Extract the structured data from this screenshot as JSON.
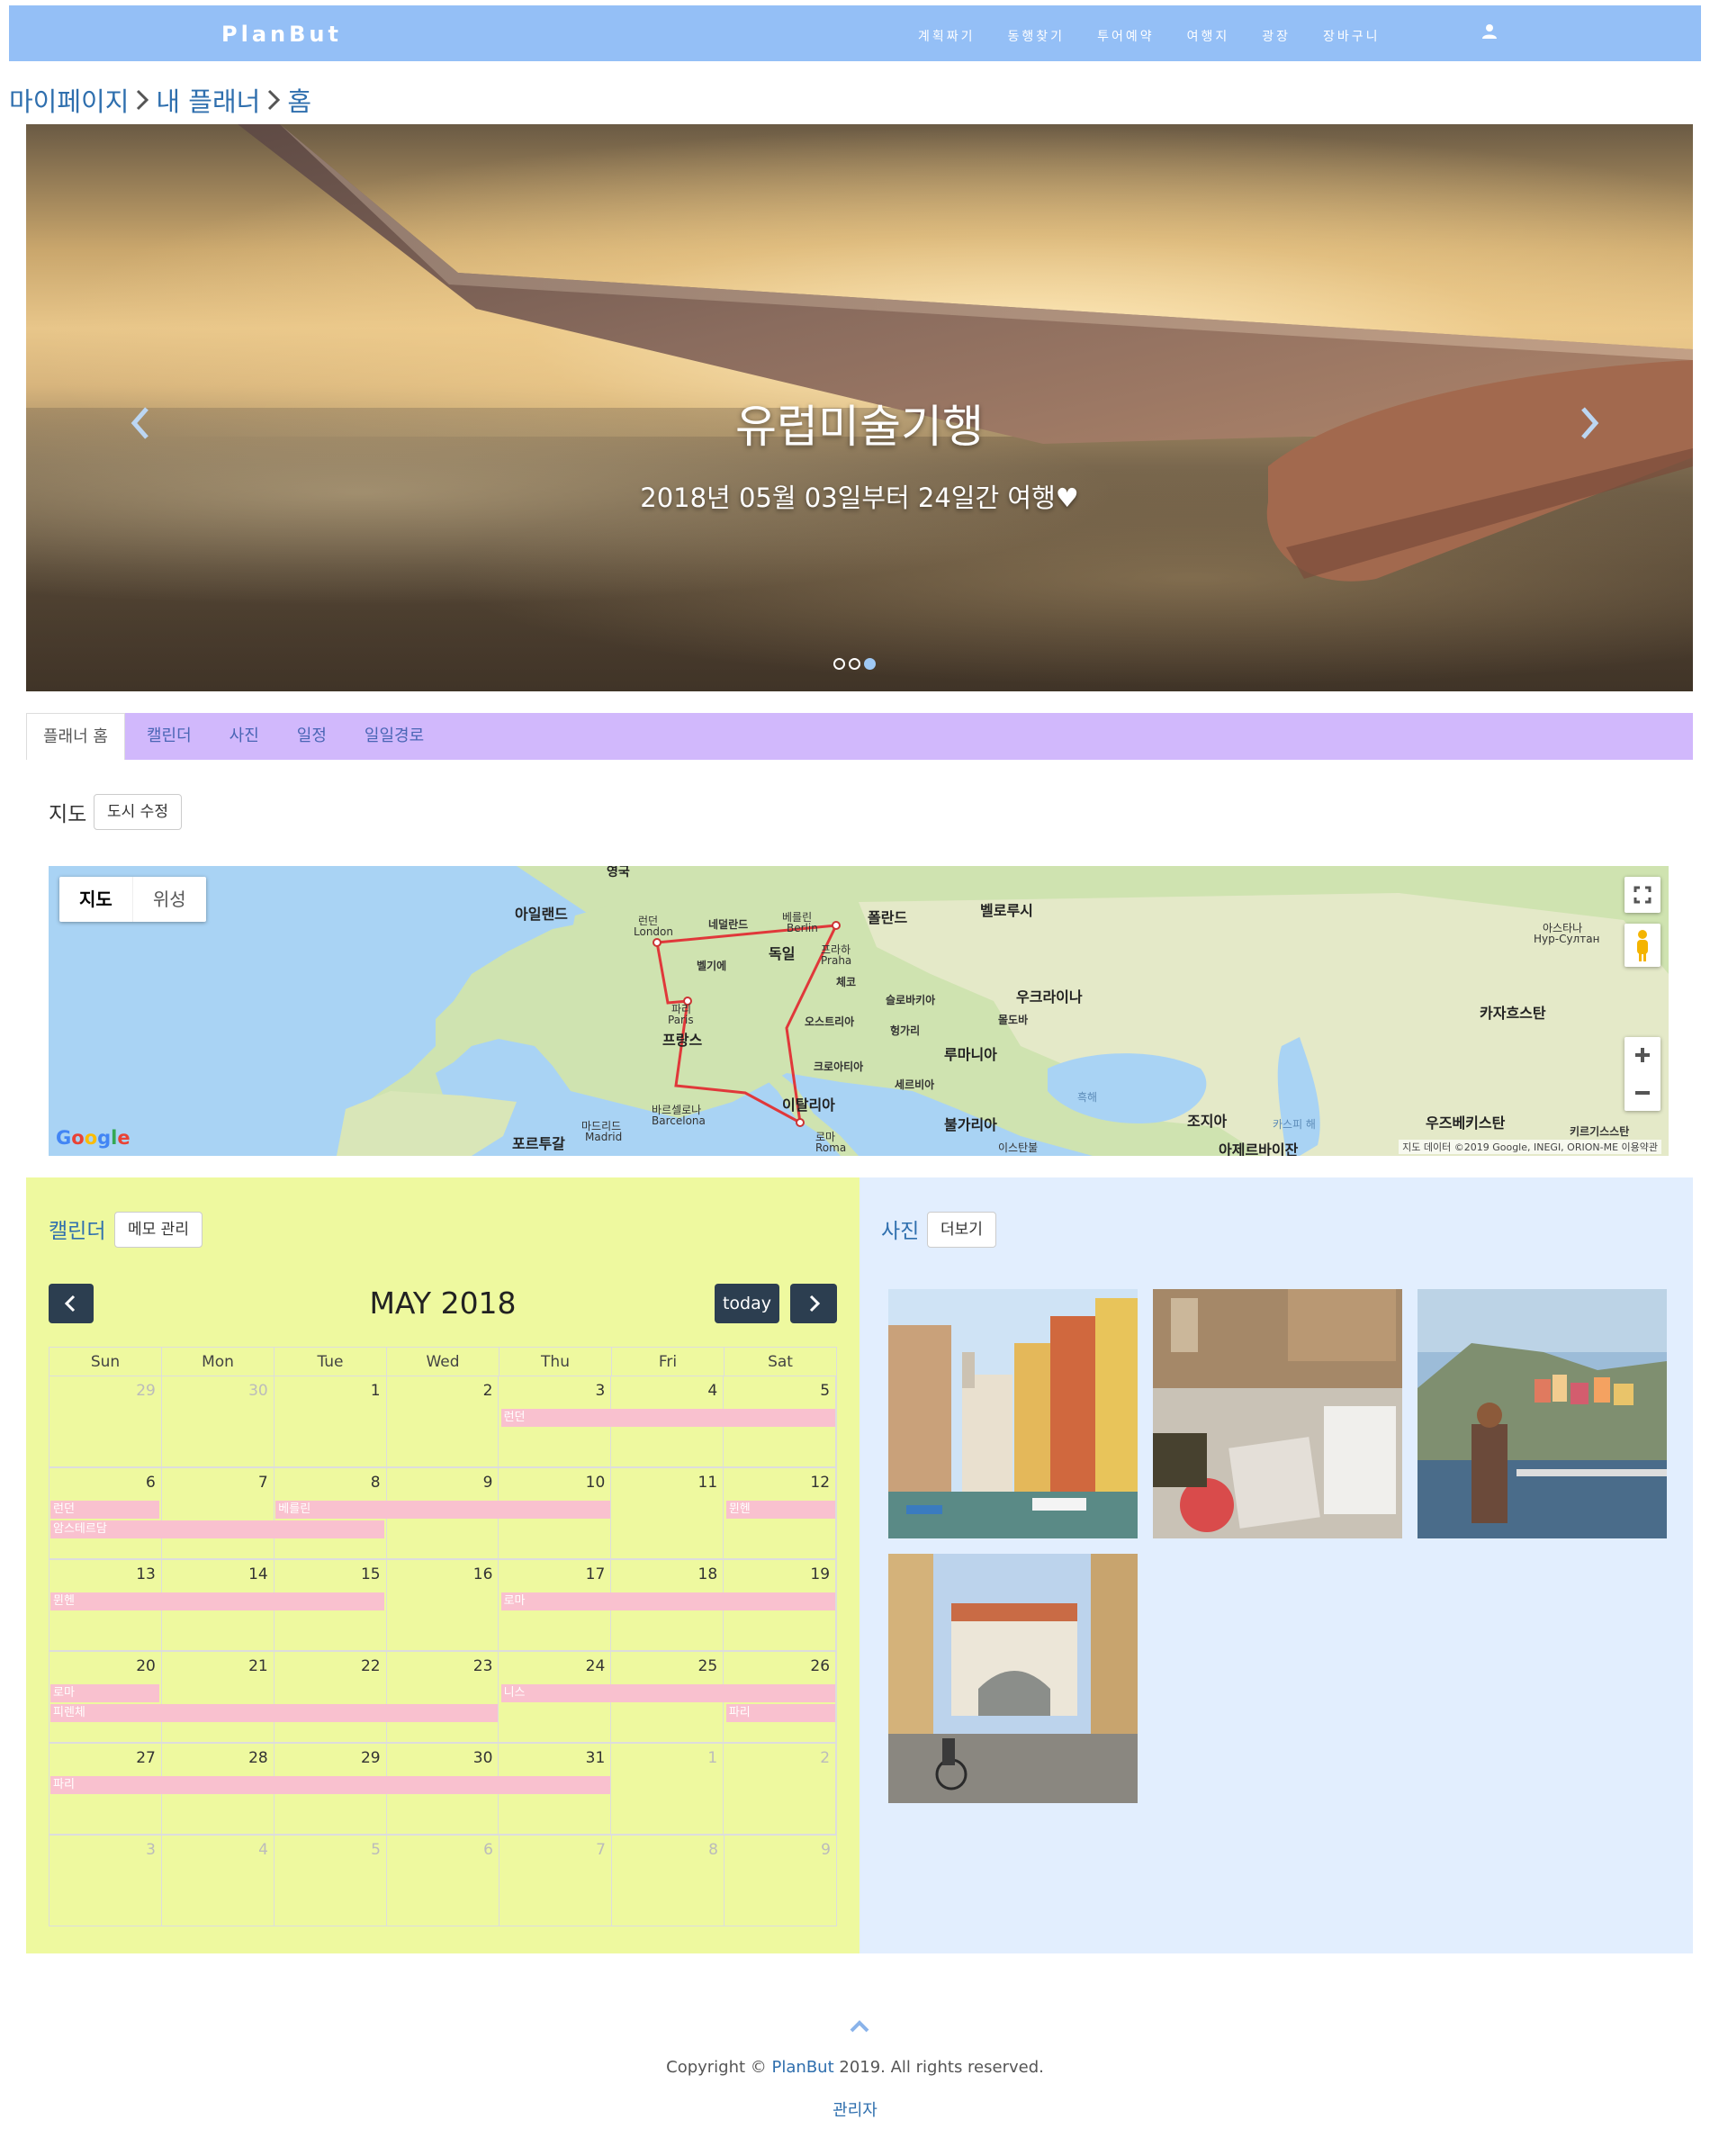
{
  "nav": {
    "brand": "PlanBut",
    "links": [
      "계획짜기",
      "동행찾기",
      "투어예약",
      "여행지",
      "광장",
      "장바구니"
    ]
  },
  "breadcrumb": [
    "마이페이지",
    "내 플래너",
    "홈"
  ],
  "hero": {
    "title": "유럽미술기행",
    "subtitle": "2018년 05월 03일부터 24일간 여행♥",
    "slide_count": 3,
    "active_slide": 3
  },
  "tabs": [
    "플래너 홈",
    "캘린더",
    "사진",
    "일정",
    "일일경로"
  ],
  "map_section": {
    "heading": "지도",
    "edit_button": "도시 수정",
    "map_type": [
      "지도",
      "위성"
    ],
    "labels": {
      "uk": "영국",
      "ireland": "아일랜드",
      "london": "런던",
      "london_en": "London",
      "netherlands": "네덜란드",
      "berlin": "베를린",
      "berlin_en": "Berlin",
      "germany": "독일",
      "poland": "폴란드",
      "belarus": "벨로루시",
      "belgium": "벨기에",
      "prague": "프라하",
      "prague_en": "Praha",
      "czech": "체코",
      "paris": "파리",
      "paris_en": "Paris",
      "france": "프랑스",
      "slovakia": "슬로바키아",
      "ukraine": "우크라이나",
      "moldova": "몰도바",
      "austria": "오스트리아",
      "hungary": "헝가리",
      "romania": "루마니아",
      "croatia": "크로아티아",
      "serbia": "세르비아",
      "italy": "이탈리아",
      "barcelona": "바르셀로나",
      "barcelona_en": "Barcelona",
      "madrid": "마드리드",
      "madrid_en": "Madrid",
      "portugal": "포르투갈",
      "rome": "로마",
      "rome_en": "Roma",
      "bulgaria": "불가리아",
      "istanbul": "이스탄불",
      "blacksea": "흑해",
      "georgia": "조지아",
      "azerbaijan": "아제르바이잔",
      "caspian": "카스피 해",
      "kazakhstan": "카자흐스탄",
      "astana": "아스타나",
      "astana_ru": "Нур-Султан",
      "uzbekistan": "우즈베키스탄",
      "kyrgyzstan": "키르기스스탄"
    },
    "google": "Google",
    "copyright": "지도 데이터 ©2019 Google, INEGI, ORION-ME  이용약관"
  },
  "calendar": {
    "title": "캘린더",
    "memo_button": "메모 관리",
    "month_title": "MAY 2018",
    "today_button": "today",
    "weekdays": [
      "Sun",
      "Mon",
      "Tue",
      "Wed",
      "Thu",
      "Fri",
      "Sat"
    ],
    "weeks": [
      {
        "days": [
          "29",
          "30",
          "1",
          "2",
          "3",
          "4",
          "5"
        ],
        "other": [
          true,
          true,
          false,
          false,
          false,
          false,
          false
        ]
      },
      {
        "days": [
          "6",
          "7",
          "8",
          "9",
          "10",
          "11",
          "12"
        ],
        "other": [
          false,
          false,
          false,
          false,
          false,
          false,
          false
        ]
      },
      {
        "days": [
          "13",
          "14",
          "15",
          "16",
          "17",
          "18",
          "19"
        ],
        "other": [
          false,
          false,
          false,
          false,
          false,
          false,
          false
        ]
      },
      {
        "days": [
          "20",
          "21",
          "22",
          "23",
          "24",
          "25",
          "26"
        ],
        "other": [
          false,
          false,
          false,
          false,
          false,
          false,
          false
        ]
      },
      {
        "days": [
          "27",
          "28",
          "29",
          "30",
          "31",
          "1",
          "2"
        ],
        "other": [
          false,
          false,
          false,
          false,
          false,
          true,
          true
        ]
      },
      {
        "days": [
          "3",
          "4",
          "5",
          "6",
          "7",
          "8",
          "9"
        ],
        "other": [
          true,
          true,
          true,
          true,
          true,
          true,
          true
        ]
      }
    ],
    "events": [
      {
        "label": "런던",
        "week": 0,
        "start": 4,
        "span": 3,
        "row": 0
      },
      {
        "label": "런던",
        "week": 1,
        "start": 0,
        "span": 1,
        "row": 0
      },
      {
        "label": "베를린",
        "week": 1,
        "start": 2,
        "span": 3,
        "row": 0
      },
      {
        "label": "뮌헨",
        "week": 1,
        "start": 6,
        "span": 1,
        "row": 0
      },
      {
        "label": "암스테르담",
        "week": 1,
        "start": 0,
        "span": 3,
        "row": 1
      },
      {
        "label": "뮌헨",
        "week": 2,
        "start": 0,
        "span": 3,
        "row": 0
      },
      {
        "label": "로마",
        "week": 2,
        "start": 4,
        "span": 3,
        "row": 0
      },
      {
        "label": "로마",
        "week": 3,
        "start": 0,
        "span": 1,
        "row": 0
      },
      {
        "label": "니스",
        "week": 3,
        "start": 4,
        "span": 3,
        "row": 0
      },
      {
        "label": "피렌체",
        "week": 3,
        "start": 0,
        "span": 4,
        "row": 1
      },
      {
        "label": "파리",
        "week": 3,
        "start": 6,
        "span": 1,
        "row": 1
      },
      {
        "label": "파리",
        "week": 4,
        "start": 0,
        "span": 5,
        "row": 0
      }
    ]
  },
  "photos": {
    "title": "사진",
    "more_button": "더보기",
    "items": [
      "photo-venice-canal",
      "photo-picnic-square",
      "photo-cinque-terre",
      "photo-arch-street"
    ]
  },
  "footer": {
    "copyright_prefix": "Copyright © ",
    "brand": "PlanBut",
    "copyright_suffix": " 2019. All rights reserved.",
    "admin": "관리자"
  },
  "colors": {
    "navbar": "#94bff6",
    "tabs": "#d1b8fc",
    "calendar_bg": "#eef99f",
    "photo_bg": "#e2eefe",
    "event": "#f9c1cf",
    "link": "#2f6fae",
    "fc_button": "#2c3e50"
  }
}
